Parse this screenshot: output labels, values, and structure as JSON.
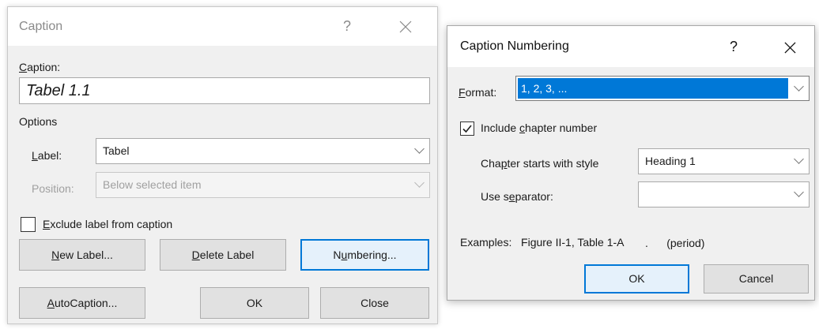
{
  "caption_dialog": {
    "title": "Caption",
    "help_glyph": "?",
    "close_icon": "close-icon",
    "caption_label": "Caption:",
    "caption_value": "Tabel  1.1",
    "options_label": "Options",
    "label_label": "Label:",
    "label_value": "Tabel",
    "position_label": "Position:",
    "position_value": "Below selected item",
    "exclude_label": "Exclude label from caption",
    "exclude_checked": false,
    "new_label_button": "New Label...",
    "delete_label_button": "Delete Label",
    "numbering_button": "Numbering...",
    "autocaption_button": "AutoCaption...",
    "ok_button": "OK",
    "close_button": "Close"
  },
  "numbering_dialog": {
    "title": "Caption Numbering",
    "help_glyph": "?",
    "close_icon": "close-icon",
    "format_label": "Format:",
    "format_value": "1, 2, 3, ...",
    "include_chapter_label": "Include chapter number",
    "include_chapter_checked": true,
    "chapter_style_label": "Chapter starts with style",
    "chapter_style_value": "Heading 1",
    "separator_label": "Use separator:",
    "separator_value": ".      (period)",
    "examples_text": "Examples:   Figure II-1, Table 1-A",
    "ok_button": "OK",
    "cancel_button": "Cancel"
  },
  "colors": {
    "accent": "#0078d7",
    "dialog_bg": "#f0f0f0",
    "button_bg": "#e1e1e1"
  }
}
